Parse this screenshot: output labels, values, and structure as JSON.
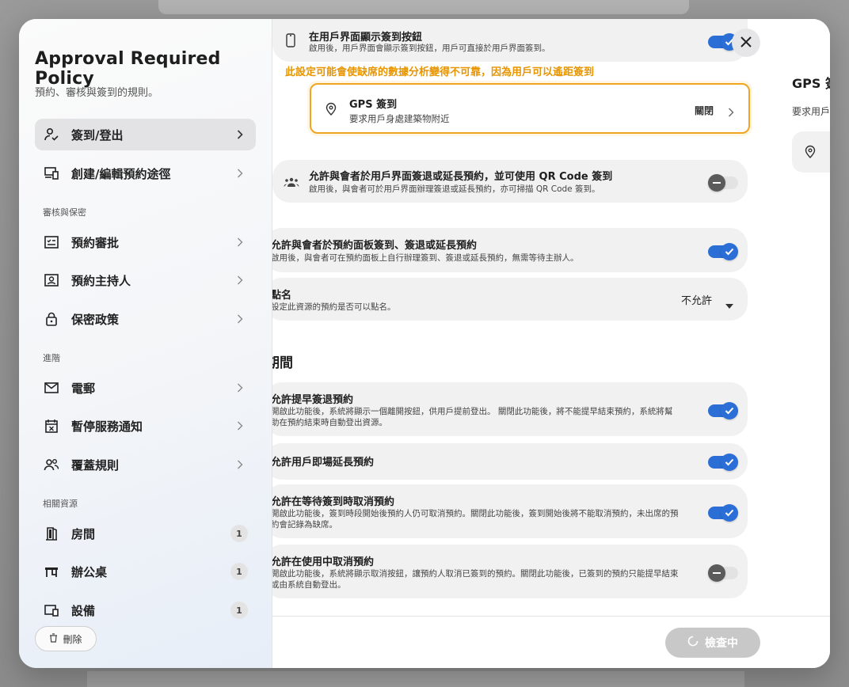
{
  "sidebar": {
    "title": "Approval Required Policy",
    "subtitle": "預約、審核與簽到的規則。",
    "items": [
      {
        "label": "簽到/登出",
        "icon": "user-check-icon"
      },
      {
        "label": "創建/編輯預約途徑",
        "icon": "devices-icon"
      },
      {
        "label": "預約審批",
        "icon": "approval-list-icon"
      },
      {
        "label": "預約主持人",
        "icon": "host-badge-icon"
      },
      {
        "label": "保密政策",
        "icon": "lock-icon"
      },
      {
        "label": "電郵",
        "icon": "mail-icon"
      },
      {
        "label": "暫停服務通知",
        "icon": "calendar-x-icon"
      },
      {
        "label": "覆蓋規則",
        "icon": "people-icon"
      },
      {
        "label": "房間",
        "icon": "door-icon",
        "count": "1"
      },
      {
        "label": "辦公桌",
        "icon": "desk-icon",
        "count": "1"
      },
      {
        "label": "設備",
        "icon": "device-icon",
        "count": "1"
      }
    ],
    "sections": [
      "審核與保密",
      "進階",
      "相關資源"
    ],
    "delete_label": "刪除"
  },
  "main": {
    "top_row": {
      "title": "在用戶界面顯示簽到按鈕",
      "desc": "啟用後，用戶界面會顯示簽到按鈕，用戶可直接於用戶界面簽到。"
    },
    "warning": "此設定可能會使缺席的數據分析變得不可靠，因為用戶可以遙距簽到",
    "gps": {
      "title": "GPS 簽到",
      "desc": "要求用戶身處建築物附近",
      "status": "關閉"
    },
    "rows": [
      {
        "title": "允許與會者於用戶界面簽退或延長預約，並可使用 QR Code 簽到",
        "desc": "啟用後，與會者可於用戶界面辦理簽退或延長預約，亦可掃描 QR Code 簽到。",
        "on": false
      },
      {
        "title": "允許與會者於預約面板簽到、簽退或延長預約",
        "desc": "啟用後，與會者可在預約面板上自行辦理簽到、簽退或延長預約，無需等待主辦人。",
        "on": true
      }
    ],
    "roll_call": {
      "title": "點名",
      "desc": "設定此資源的預約是否可以點名。",
      "value": "不允許"
    },
    "section_heading": "期間",
    "period_rows": [
      {
        "title": "允許提早簽退預約",
        "desc_1": "開啟此功能後，系統將顯示一個離開按鈕，供用戶提前登出。 關閉此功能後，將不能提早結束預約，系統將幫",
        "desc_2": "助在預約結束時自動登出資源。",
        "on": true
      },
      {
        "title": "允許用戶即場延長預約",
        "on": true
      },
      {
        "title": "允許在等待簽到時取消預約",
        "desc_1": "開啟此功能後，簽到時段開始後預約人仍可取消預約。關閉此功能後，簽到開始後將不能取消預約，未出席的預",
        "desc_2": "約會記錄為缺席。",
        "on": true
      },
      {
        "title": "允許在使用中取消預約",
        "desc_1": "開啟此功能後，系統將顯示取消按鈕，讓預約人取消已簽到的預約。關閉此功能後，已簽到的預約只能提早結束",
        "desc_2": "或由系統自動登出。",
        "on": false
      }
    ],
    "check_button": "檢查中"
  },
  "right_panel": {
    "title": "GPS 簽到",
    "sub": "要求用戶身處建築物附近"
  },
  "colors": {
    "accent": "#2b6fd6",
    "warning": "#e79500",
    "border_highlight": "#f0a521"
  }
}
